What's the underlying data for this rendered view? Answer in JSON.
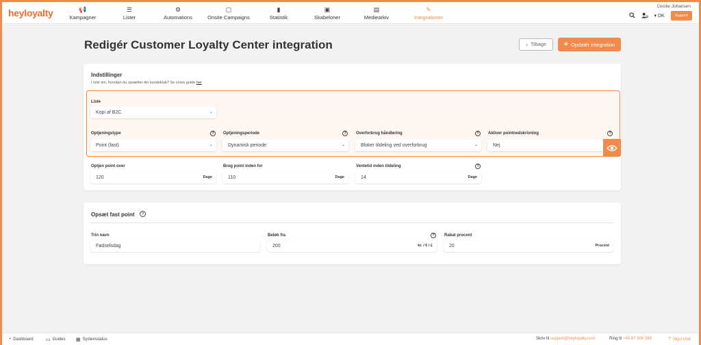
{
  "app": {
    "logo_prefix": "hey",
    "logo_suffix": "loyalty"
  },
  "nav": [
    {
      "label": "Kampagner",
      "icon": "megaphone-icon",
      "glyph": "📢"
    },
    {
      "label": "Lister",
      "icon": "list-icon",
      "glyph": "☰"
    },
    {
      "label": "Automations",
      "icon": "automations-icon",
      "glyph": "⚙"
    },
    {
      "label": "Onsite Campaigns",
      "icon": "onsite-icon",
      "glyph": "▢"
    },
    {
      "label": "Statistik",
      "icon": "statistics-icon",
      "glyph": "▮"
    },
    {
      "label": "Skabeloner",
      "icon": "templates-icon",
      "glyph": "▣"
    },
    {
      "label": "Mediearkiv",
      "icon": "media-icon",
      "glyph": "▤"
    },
    {
      "label": "Integrationer",
      "icon": "integrations-icon",
      "glyph": "✎"
    }
  ],
  "colors": {
    "accent": "#f28a4b",
    "background": "#f2f2f3"
  },
  "user": {
    "name": "Cecilie Johansen",
    "language": "DK",
    "support_label": "Support"
  },
  "page": {
    "title": "Redigér Customer Loyalty Center integration",
    "back_label": "Tilbage",
    "update_label": "Opdatér integration"
  },
  "settings": {
    "title": "Indstillinger",
    "subtitle": "I tvivl om, hvordan du opsætter din kundeklub? Se vores guide",
    "guide_link": "her",
    "list_label": "Liste",
    "list_value": "Kopi af B2C",
    "earning_type_label": "Optjeningstype",
    "earning_type_value": "Point (fast)",
    "earning_period_label": "Optjeningsperiode",
    "earning_period_value": "Dynamisk periode",
    "overuse_label": "Overforbrug håndtering",
    "overuse_value": "Bloker tildeling ved overforbrug",
    "activate_writedown_label": "Aktiver pointnedskrivning",
    "activate_writedown_value": "Nej",
    "earn_over_label": "Optjen point over",
    "earn_over_value": "120",
    "earn_over_unit": "Dage",
    "use_within_label": "Brug point inden for",
    "use_within_value": "110",
    "use_within_unit": "Dage",
    "wait_label": "Ventetid inden tildeling",
    "wait_value": "14",
    "wait_unit": "Dage"
  },
  "fixed_point": {
    "title": "Opsæt fast point",
    "step_name_label": "Trin navn",
    "step_name_value": "Fødselsdag",
    "amount_from_label": "Beløb fra",
    "amount_from_value": "200",
    "amount_from_unit": "kr. / € / £",
    "discount_label": "Rabat procent",
    "discount_value": "20",
    "discount_unit": "Procent"
  },
  "footer": {
    "dashboard": "Dashboard",
    "guides": "Guides",
    "systemstatus": "Systemstatus",
    "write_prefix": "Skriv til",
    "email": "support@heyloyalty.com",
    "call_prefix": "Ring til",
    "phone": "+45 87 300 399",
    "hide_chat": "Skjul chat"
  }
}
